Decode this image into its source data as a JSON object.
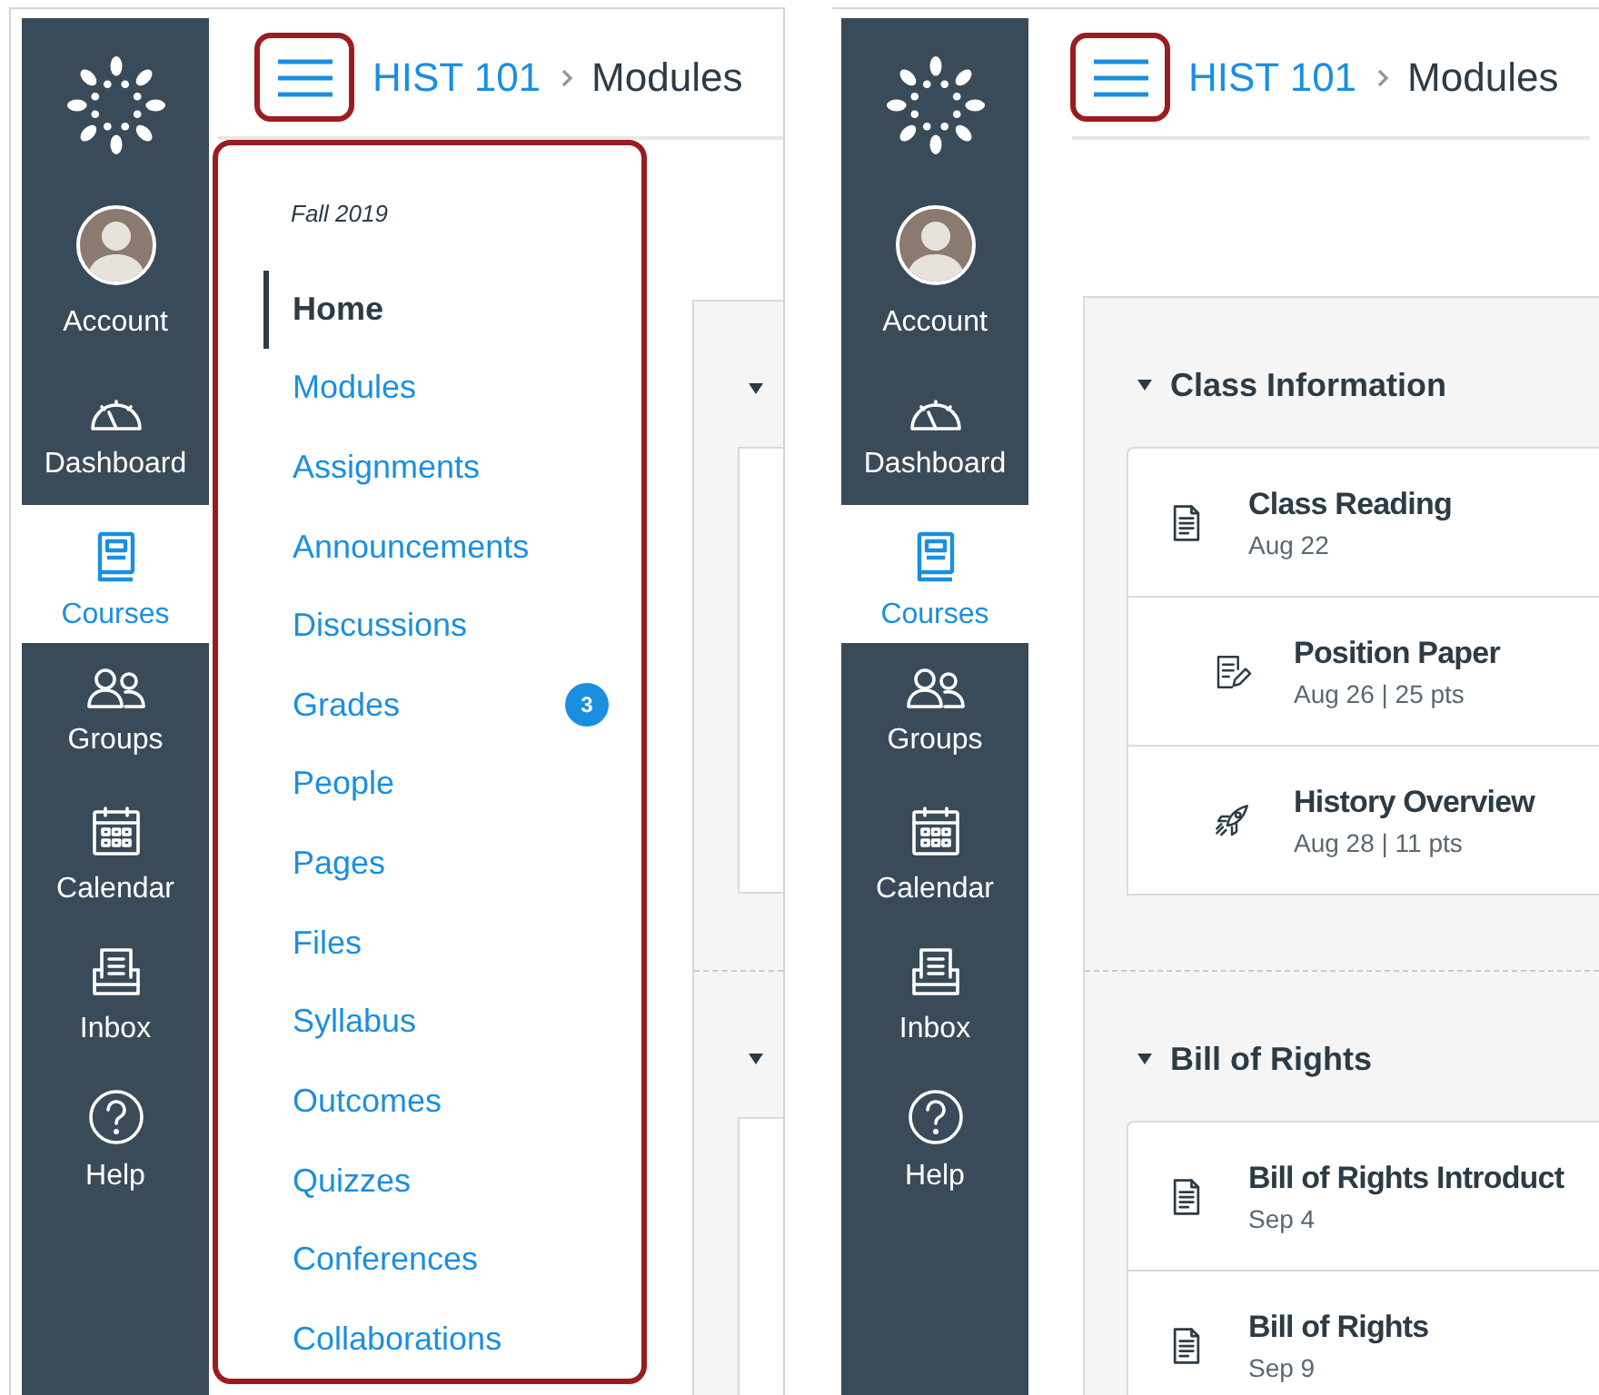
{
  "panels": [
    {
      "global_nav": [
        {
          "label": "Account",
          "kind": "account",
          "selected": false
        },
        {
          "label": "Dashboard",
          "kind": "dashboard",
          "selected": false
        },
        {
          "label": "Courses",
          "kind": "courses",
          "selected": true
        },
        {
          "label": "Groups",
          "kind": "groups",
          "selected": false
        },
        {
          "label": "Calendar",
          "kind": "calendar",
          "selected": false
        },
        {
          "label": "Inbox",
          "kind": "inbox",
          "selected": false
        },
        {
          "label": "Help",
          "kind": "help",
          "selected": false
        }
      ],
      "breadcrumb": {
        "course": "HIST 101",
        "page": "Modules"
      },
      "course_menu": {
        "term": "Fall 2019",
        "items": [
          {
            "label": "Home",
            "selected": true
          },
          {
            "label": "Modules",
            "selected": false
          },
          {
            "label": "Assignments",
            "selected": false
          },
          {
            "label": "Announcements",
            "selected": false
          },
          {
            "label": "Discussions",
            "selected": false
          },
          {
            "label": "Grades",
            "selected": false,
            "badge": "3"
          },
          {
            "label": "People",
            "selected": false
          },
          {
            "label": "Pages",
            "selected": false
          },
          {
            "label": "Files",
            "selected": false
          },
          {
            "label": "Syllabus",
            "selected": false
          },
          {
            "label": "Outcomes",
            "selected": false
          },
          {
            "label": "Quizzes",
            "selected": false
          },
          {
            "label": "Conferences",
            "selected": false
          },
          {
            "label": "Collaborations",
            "selected": false
          }
        ]
      }
    },
    {
      "global_nav": [
        {
          "label": "Account",
          "kind": "account",
          "selected": false
        },
        {
          "label": "Dashboard",
          "kind": "dashboard",
          "selected": false
        },
        {
          "label": "Courses",
          "kind": "courses",
          "selected": true
        },
        {
          "label": "Groups",
          "kind": "groups",
          "selected": false
        },
        {
          "label": "Calendar",
          "kind": "calendar",
          "selected": false
        },
        {
          "label": "Inbox",
          "kind": "inbox",
          "selected": false
        },
        {
          "label": "Help",
          "kind": "help",
          "selected": false
        }
      ],
      "breadcrumb": {
        "course": "HIST 101",
        "page": "Modules"
      },
      "modules": [
        {
          "title": "Class Information",
          "expanded": true,
          "items": [
            {
              "kind": "page",
              "title": "Class Reading",
              "details": "Aug 22",
              "indented": false
            },
            {
              "kind": "assignment",
              "title": "Position Paper",
              "details": "Aug 26 | 25 pts",
              "indented": true
            },
            {
              "kind": "quiz",
              "title": "History Overview",
              "details": "Aug 28 | 11 pts",
              "indented": true
            }
          ]
        },
        {
          "title": "Bill of Rights",
          "expanded": true,
          "items": [
            {
              "kind": "page",
              "title": "Bill of Rights Introduct",
              "details": "Sep 4",
              "indented": false
            },
            {
              "kind": "page",
              "title": "Bill of Rights",
              "details": "Sep 9",
              "indented": false
            }
          ]
        }
      ]
    }
  ]
}
